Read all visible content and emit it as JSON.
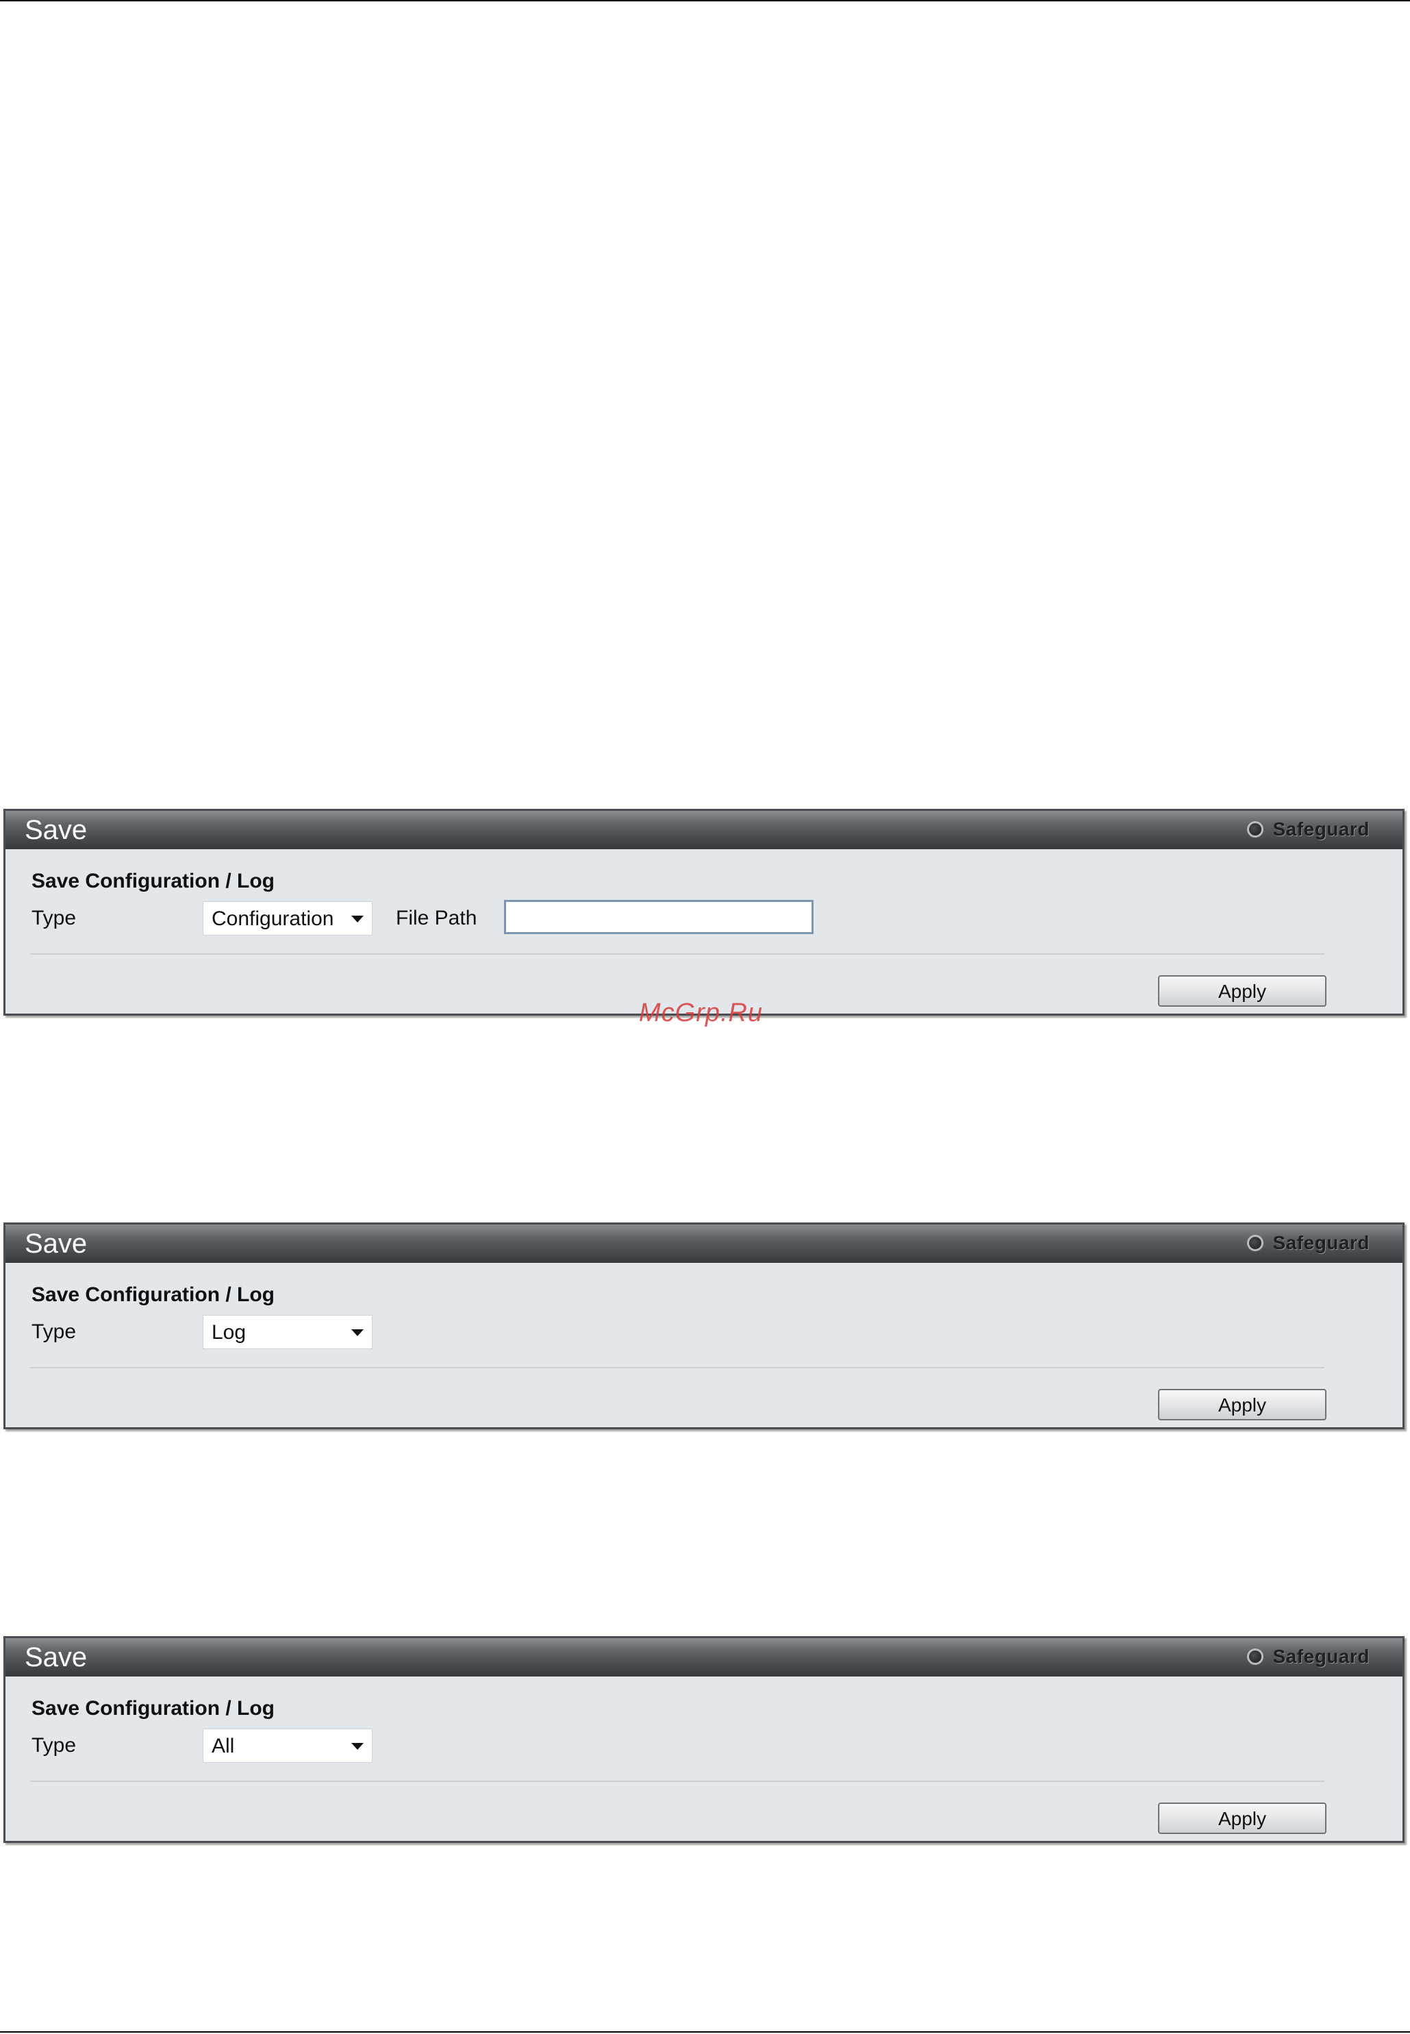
{
  "watermark": "McGrp.Ru",
  "panels": [
    {
      "title": "Save",
      "safeguard_label": "Safeguard",
      "section_title": "Save Configuration / Log",
      "type_label": "Type",
      "type_value": "Configuration",
      "file_path_label": "File Path",
      "file_path_value": "",
      "apply_label": "Apply"
    },
    {
      "title": "Save",
      "safeguard_label": "Safeguard",
      "section_title": "Save Configuration / Log",
      "type_label": "Type",
      "type_value": "Log",
      "apply_label": "Apply"
    },
    {
      "title": "Save",
      "safeguard_label": "Safeguard",
      "section_title": "Save Configuration / Log",
      "type_label": "Type",
      "type_value": "All",
      "apply_label": "Apply"
    }
  ],
  "icons": {
    "safeguard_indicator": "safeguard-indicator-icon",
    "dropdown_arrow": "chevron-down-icon"
  },
  "colors": {
    "header_dark": "#35383c",
    "panel_background": "#e2e7eb",
    "watermark": "#d73c3c"
  }
}
